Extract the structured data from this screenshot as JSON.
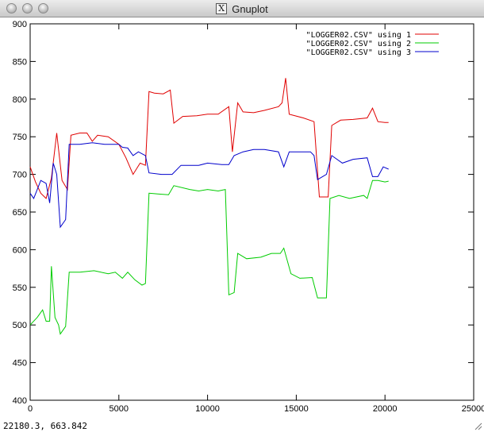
{
  "window": {
    "title": "Gnuplot",
    "app_icon": "x11-icon"
  },
  "status": {
    "mouse_coords": "22180.3,  663.842"
  },
  "chart_data": {
    "type": "line",
    "xlim": [
      0,
      25000
    ],
    "ylim": [
      400,
      900
    ],
    "x_ticks": [
      "0",
      "5000",
      "10000",
      "15000",
      "20000",
      "25000"
    ],
    "y_ticks": [
      "400",
      "450",
      "500",
      "550",
      "600",
      "650",
      "700",
      "750",
      "800",
      "850",
      "900"
    ],
    "grid": false,
    "legend": "top-right",
    "series": [
      {
        "name": "\"LOGGER02.CSV\" using 1",
        "color": "#e00000",
        "points": [
          [
            0,
            710
          ],
          [
            300,
            690
          ],
          [
            600,
            675
          ],
          [
            900,
            668
          ],
          [
            1200,
            695
          ],
          [
            1500,
            755
          ],
          [
            1800,
            692
          ],
          [
            2100,
            680
          ],
          [
            2300,
            752
          ],
          [
            2800,
            755
          ],
          [
            3200,
            755
          ],
          [
            3500,
            744
          ],
          [
            3800,
            752
          ],
          [
            4400,
            750
          ],
          [
            5000,
            740
          ],
          [
            5400,
            722
          ],
          [
            5800,
            700
          ],
          [
            6200,
            715
          ],
          [
            6500,
            712
          ],
          [
            6700,
            810
          ],
          [
            7000,
            808
          ],
          [
            7500,
            807
          ],
          [
            7900,
            812
          ],
          [
            8100,
            768
          ],
          [
            8600,
            777
          ],
          [
            9400,
            778
          ],
          [
            10000,
            780
          ],
          [
            10600,
            780
          ],
          [
            11200,
            790
          ],
          [
            11400,
            730
          ],
          [
            11700,
            795
          ],
          [
            12000,
            783
          ],
          [
            12600,
            782
          ],
          [
            13200,
            785
          ],
          [
            14000,
            790
          ],
          [
            14200,
            795
          ],
          [
            14400,
            828
          ],
          [
            14600,
            780
          ],
          [
            15400,
            775
          ],
          [
            16000,
            770
          ],
          [
            16300,
            670
          ],
          [
            16800,
            670
          ],
          [
            17000,
            765
          ],
          [
            17500,
            772
          ],
          [
            18200,
            773
          ],
          [
            19000,
            775
          ],
          [
            19300,
            788
          ],
          [
            19600,
            770
          ],
          [
            20000,
            769
          ],
          [
            20200,
            769
          ]
        ]
      },
      {
        "name": "\"LOGGER02.CSV\" using 2",
        "color": "#00cc00",
        "points": [
          [
            0,
            500
          ],
          [
            400,
            510
          ],
          [
            700,
            520
          ],
          [
            900,
            505
          ],
          [
            1100,
            505
          ],
          [
            1200,
            578
          ],
          [
            1400,
            510
          ],
          [
            1600,
            500
          ],
          [
            1700,
            488
          ],
          [
            2000,
            498
          ],
          [
            2200,
            570
          ],
          [
            2800,
            570
          ],
          [
            3600,
            572
          ],
          [
            4400,
            568
          ],
          [
            4800,
            570
          ],
          [
            5200,
            562
          ],
          [
            5500,
            570
          ],
          [
            5900,
            560
          ],
          [
            6300,
            553
          ],
          [
            6500,
            555
          ],
          [
            6700,
            675
          ],
          [
            7200,
            674
          ],
          [
            7800,
            673
          ],
          [
            8100,
            685
          ],
          [
            9000,
            680
          ],
          [
            9500,
            678
          ],
          [
            10000,
            680
          ],
          [
            10600,
            678
          ],
          [
            11000,
            680
          ],
          [
            11200,
            540
          ],
          [
            11500,
            543
          ],
          [
            11700,
            595
          ],
          [
            12200,
            588
          ],
          [
            13000,
            590
          ],
          [
            13600,
            595
          ],
          [
            14100,
            595
          ],
          [
            14300,
            602
          ],
          [
            14700,
            568
          ],
          [
            15200,
            562
          ],
          [
            15900,
            563
          ],
          [
            16200,
            536
          ],
          [
            16700,
            536
          ],
          [
            16900,
            668
          ],
          [
            17400,
            672
          ],
          [
            18000,
            668
          ],
          [
            18800,
            672
          ],
          [
            19000,
            668
          ],
          [
            19300,
            692
          ],
          [
            19600,
            692
          ],
          [
            20000,
            690
          ],
          [
            20200,
            691
          ]
        ]
      },
      {
        "name": "\"LOGGER02.CSV\" using 3",
        "color": "#0000cc",
        "points": [
          [
            0,
            675
          ],
          [
            200,
            668
          ],
          [
            600,
            692
          ],
          [
            900,
            688
          ],
          [
            1100,
            662
          ],
          [
            1300,
            715
          ],
          [
            1500,
            700
          ],
          [
            1700,
            630
          ],
          [
            2000,
            640
          ],
          [
            2200,
            740
          ],
          [
            2800,
            740
          ],
          [
            3500,
            742
          ],
          [
            4200,
            740
          ],
          [
            5000,
            740
          ],
          [
            5200,
            736
          ],
          [
            5500,
            735
          ],
          [
            5800,
            725
          ],
          [
            6100,
            730
          ],
          [
            6500,
            725
          ],
          [
            6700,
            702
          ],
          [
            7400,
            700
          ],
          [
            8000,
            700
          ],
          [
            8500,
            712
          ],
          [
            9500,
            712
          ],
          [
            10000,
            715
          ],
          [
            10800,
            713
          ],
          [
            11200,
            713
          ],
          [
            11500,
            725
          ],
          [
            12000,
            730
          ],
          [
            12600,
            733
          ],
          [
            13200,
            733
          ],
          [
            14000,
            730
          ],
          [
            14300,
            710
          ],
          [
            14600,
            730
          ],
          [
            15200,
            730
          ],
          [
            15800,
            730
          ],
          [
            16000,
            725
          ],
          [
            16200,
            693
          ],
          [
            16700,
            700
          ],
          [
            17000,
            725
          ],
          [
            17600,
            715
          ],
          [
            18200,
            720
          ],
          [
            19000,
            722
          ],
          [
            19300,
            697
          ],
          [
            19600,
            697
          ],
          [
            19900,
            710
          ],
          [
            20200,
            707
          ]
        ]
      }
    ]
  }
}
